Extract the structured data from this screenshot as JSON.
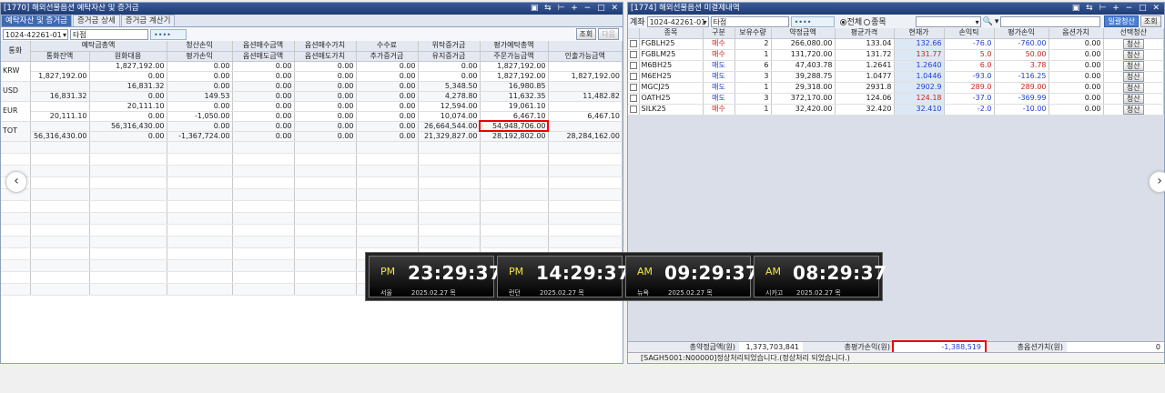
{
  "left": {
    "title": "[1770] 해외선물옵션 예탁자산 및 증거금",
    "tabs": [
      "예탁자산 및 증거금",
      "증거금 상세",
      "증거금 계산기"
    ],
    "account": "1024-42261-01",
    "account_type": "타점",
    "password": "••••",
    "btn_query": "조회",
    "btn_next": "다음",
    "headers_top": [
      "통화",
      "예탁금총액",
      "",
      "청산손익",
      "옵션매수금액",
      "옵션매수가치",
      "수수료",
      "위탁증거금",
      "평가예탁총액",
      ""
    ],
    "headers_bottom": [
      "",
      "통화잔액",
      "원화대용",
      "평가손익",
      "옵션매도금액",
      "옵션매도가치",
      "추가증거금",
      "유지증거금",
      "주문가능금액",
      "인출가능금액"
    ],
    "rows": [
      {
        "cur": "KRW",
        "r1": [
          "",
          "1,827,192.00",
          "0.00",
          "0.00",
          "0.00",
          "0.00",
          "0.00",
          "1,827,192.00",
          ""
        ],
        "r2": [
          "1,827,192.00",
          "0.00",
          "0.00",
          "0.00",
          "0.00",
          "0.00",
          "0.00",
          "1,827,192.00",
          "1,827,192.00"
        ]
      },
      {
        "cur": "USD",
        "r1": [
          "",
          "16,831.32",
          "0.00",
          "0.00",
          "0.00",
          "0.00",
          "5,348.50",
          "16,980.85",
          ""
        ],
        "r2": [
          "16,831.32",
          "0.00",
          "149.53",
          "0.00",
          "0.00",
          "0.00",
          "4,278.80",
          "11,632.35",
          "11,482.82"
        ]
      },
      {
        "cur": "EUR",
        "r1": [
          "",
          "20,111.10",
          "0.00",
          "0.00",
          "0.00",
          "0.00",
          "12,594.00",
          "19,061.10",
          ""
        ],
        "r2": [
          "20,111.10",
          "0.00",
          "-1,050.00",
          "0.00",
          "0.00",
          "0.00",
          "10,074.00",
          "6,467.10",
          "6,467.10"
        ]
      },
      {
        "cur": "TOT",
        "r1": [
          "",
          "56,316,430.00",
          "0.00",
          "0.00",
          "0.00",
          "0.00",
          "26,664,544.00",
          "54,948,706.00",
          ""
        ],
        "r2": [
          "56,316,430.00",
          "0.00",
          "-1,367,724.00",
          "0.00",
          "0.00",
          "0.00",
          "21,329,827.00",
          "28,192,802.00",
          "28,284,162.00"
        ]
      }
    ]
  },
  "right": {
    "title": "[1774] 해외선물옵션 미결제내역",
    "account_label": "계좌",
    "account": "1024-42261-01",
    "account_type": "타점",
    "password": "••••",
    "radio_all": "전체",
    "radio_item": "종목",
    "btn_liquidate_all": "일괄청산",
    "btn_query": "조회",
    "headers": [
      "",
      "종목",
      "구분",
      "보유수량",
      "약정금액",
      "평균가격",
      "현재가",
      "손익틱",
      "평가손익",
      "옵션가치",
      "선택청산"
    ],
    "rows": [
      {
        "sym": "FGBLH25",
        "side": "매수",
        "qty": "2",
        "amt": "266,080.00",
        "avg": "133.04",
        "cur": "132.66",
        "tick": "-76.0",
        "pnl": "-760.00",
        "opt": "0.00"
      },
      {
        "sym": "FGBLM25",
        "side": "매수",
        "qty": "1",
        "amt": "131,720.00",
        "avg": "131.72",
        "cur": "131.77",
        "tick": "5.0",
        "pnl": "50.00",
        "opt": "0.00"
      },
      {
        "sym": "M6BH25",
        "side": "매도",
        "qty": "6",
        "amt": "47,403.78",
        "avg": "1.2641",
        "cur": "1.2640",
        "tick": "6.0",
        "pnl": "3.78",
        "opt": "0.00"
      },
      {
        "sym": "M6EH25",
        "side": "매도",
        "qty": "3",
        "amt": "39,288.75",
        "avg": "1.0477",
        "cur": "1.0446",
        "tick": "-93.0",
        "pnl": "-116.25",
        "opt": "0.00"
      },
      {
        "sym": "MGCJ25",
        "side": "매도",
        "qty": "1",
        "amt": "29,318.00",
        "avg": "2931.8",
        "cur": "2902.9",
        "tick": "289.0",
        "pnl": "289.00",
        "opt": "0.00"
      },
      {
        "sym": "OATH25",
        "side": "매도",
        "qty": "3",
        "amt": "372,170.00",
        "avg": "124.06",
        "cur": "124.18",
        "tick": "-37.0",
        "pnl": "-369.99",
        "opt": "0.00"
      },
      {
        "sym": "SILK25",
        "side": "매수",
        "qty": "1",
        "amt": "32,420.00",
        "avg": "32.420",
        "cur": "32.410",
        "tick": "-2.0",
        "pnl": "-10.00",
        "opt": "0.00"
      }
    ],
    "liquidate_label": "청산",
    "footer": {
      "total_amt_label": "총약정금액(원)",
      "total_amt": "1,373,703,841",
      "total_pnl_label": "총평가손익(원)",
      "total_pnl": "-1,388,519",
      "total_opt_label": "총옵션가치(원)",
      "total_opt": "0"
    },
    "message": "[SAGH5001:N00000]정상처리되었습니다.(정상처리 되었습니다.)"
  },
  "clocks": [
    {
      "ampm": "PM",
      "time": "23:29:37",
      "city": "서울",
      "date": "2025.02.27 목"
    },
    {
      "ampm": "PM",
      "time": "14:29:37",
      "city": "런던",
      "date": "2025.02.27 목"
    },
    {
      "ampm": "AM",
      "time": "09:29:37",
      "city": "뉴욕",
      "date": "2025.02.27 목"
    },
    {
      "ampm": "AM",
      "time": "08:29:37",
      "city": "시카고",
      "date": "2025.02.27 목"
    }
  ]
}
